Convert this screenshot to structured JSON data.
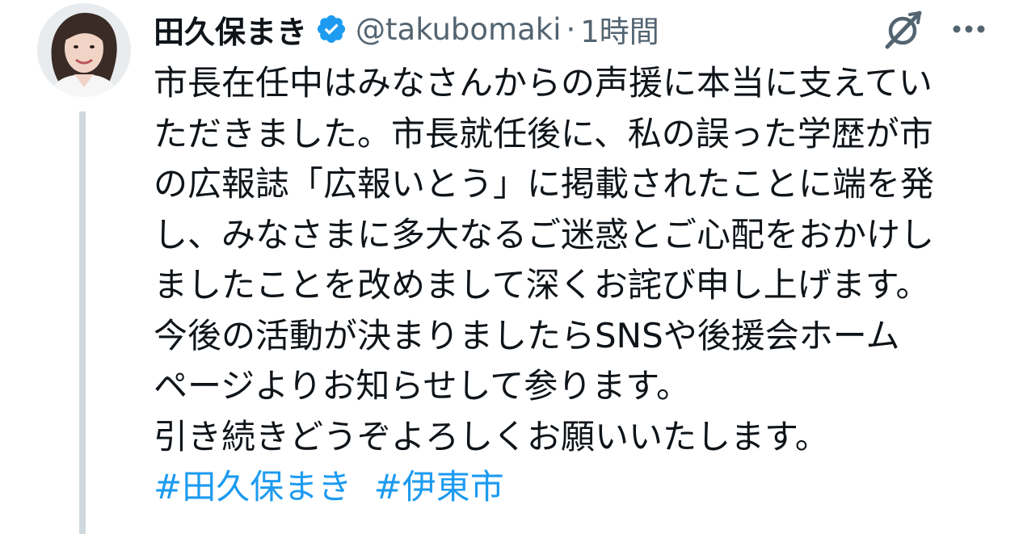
{
  "author": {
    "display_name": "田久保まき",
    "handle": "@takubomaki",
    "separator": "·",
    "time": "1時間",
    "verified_color": "#1d9bf0"
  },
  "icons": {
    "avatar": "profile-photo",
    "verified": "verified-badge-icon",
    "grok": "grok-icon",
    "more": "more-icon"
  },
  "tweet": {
    "lines": [
      "市長在任中はみなさんからの声援に本当に支えてい",
      "ただきました。市長就任後に、私の誤った学歴が市",
      "の広報誌「広報いとう」に掲載されたことに端を発",
      "し、みなさまに多大なるご迷惑とご心配をおかけし",
      "ましたことを改めまして深くお詫び申し上げます。",
      "今後の活動が決まりましたらSNSや後援会ホーム",
      "ページよりお知らせして参ります。",
      "引き続きどうぞよろしくお願いいたします。"
    ],
    "hashtags": [
      "#田久保まき",
      "#伊東市"
    ]
  },
  "colors": {
    "text": "#0f1419",
    "secondary": "#536471",
    "link": "#1d9bf0",
    "thread_line": "#cfd9de"
  }
}
